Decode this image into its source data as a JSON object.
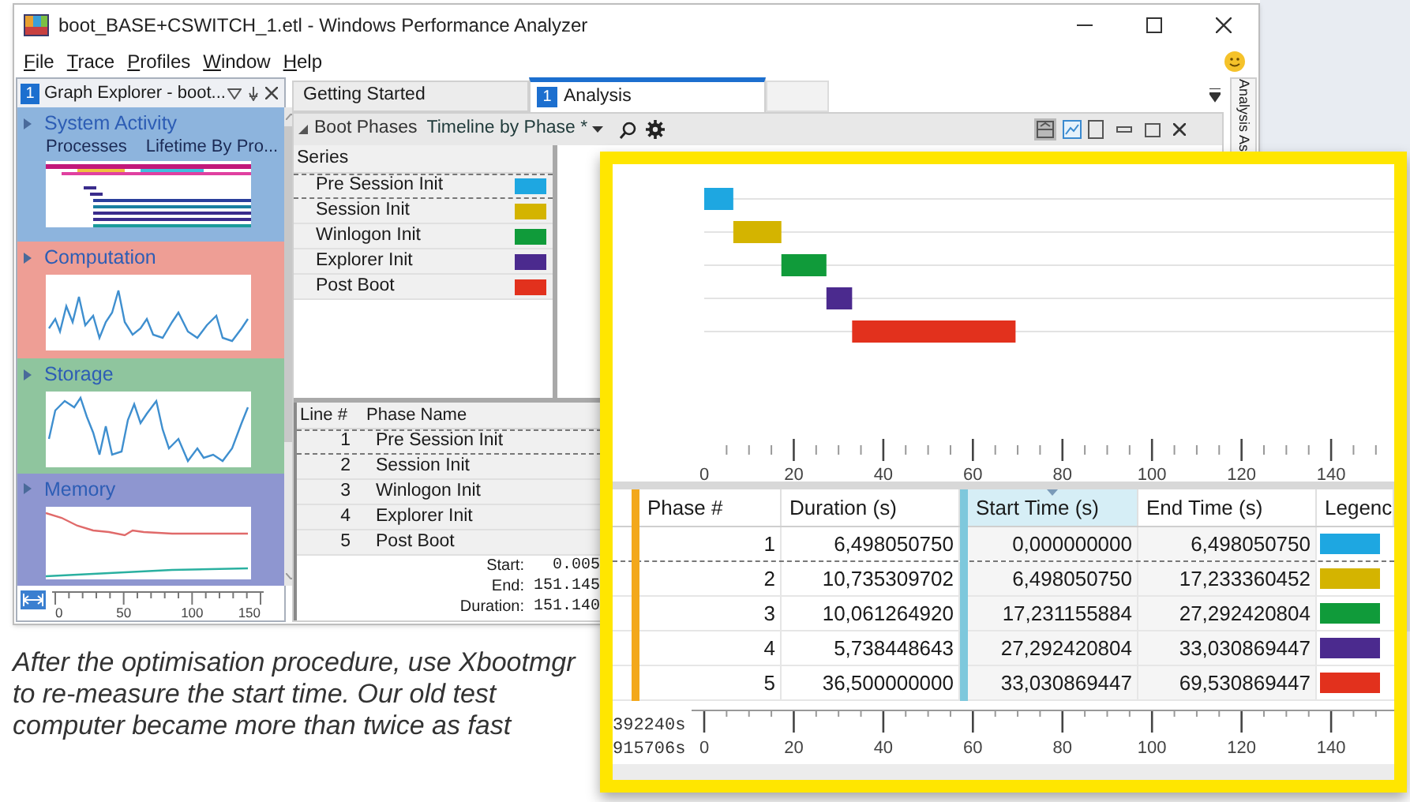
{
  "window": {
    "title": "boot_BASE+CSWITCH_1.etl - Windows Performance Analyzer"
  },
  "menu": [
    "File",
    "Trace",
    "Profiles",
    "Window",
    "Help"
  ],
  "graph_explorer": {
    "badge": "1",
    "title": "Graph Explorer - boot...",
    "sections": [
      {
        "kind": "lanes",
        "title": "System Activity",
        "subtitles": [
          "Processes",
          "Lifetime By Pro..."
        ],
        "color": "#8db4dd"
      },
      {
        "kind": "cpu",
        "title": "Computation",
        "color": "#ee9e95"
      },
      {
        "kind": "disk",
        "title": "Storage",
        "color": "#8fc59e"
      },
      {
        "kind": "memory",
        "title": "Memory",
        "color": "#8e96d0"
      }
    ],
    "axis_ticks": [
      "0",
      "50",
      "100",
      "150"
    ]
  },
  "tabs": [
    {
      "label": "Getting Started",
      "selected": false
    },
    {
      "badge": "1",
      "label": "Analysis",
      "selected": true
    }
  ],
  "toolbar": {
    "graph_name": "Boot Phases",
    "preset": "Timeline by Phase *"
  },
  "series": {
    "header": "Series",
    "items": [
      {
        "label": "Pre Session Init",
        "color": "#1ea7e1",
        "selected": true
      },
      {
        "label": "Session Init",
        "color": "#d4b400",
        "selected": false
      },
      {
        "label": "Winlogon Init",
        "color": "#109b3a",
        "selected": false
      },
      {
        "label": "Explorer Init",
        "color": "#4b2a8e",
        "selected": false
      },
      {
        "label": "Post Boot",
        "color": "#e2311d",
        "selected": false
      }
    ]
  },
  "phase_table": {
    "columns": [
      "Line #",
      "Phase Name"
    ],
    "rows": [
      {
        "line": "1",
        "name": "Pre Session Init",
        "selected": true
      },
      {
        "line": "2",
        "name": "Session Init",
        "selected": false
      },
      {
        "line": "3",
        "name": "Winlogon Init",
        "selected": false
      },
      {
        "line": "4",
        "name": "Explorer Init",
        "selected": false
      },
      {
        "line": "5",
        "name": "Post Boot",
        "selected": false
      }
    ]
  },
  "summary": [
    {
      "label": "Start:",
      "value": "0.005"
    },
    {
      "label": "End:",
      "value": "151.145"
    },
    {
      "label": "Duration:",
      "value": "151.140"
    }
  ],
  "side_tab": "Analysis As",
  "inset": {
    "timeline_ticks": [
      "0",
      "20",
      "40",
      "60",
      "80",
      "100",
      "120",
      "140"
    ],
    "table": {
      "columns": [
        "Phase #",
        "Duration (s)",
        "Start Time (s)",
        "End Time (s)",
        "Legenc"
      ],
      "rows": [
        {
          "phase": "1",
          "duration": "6,498050750",
          "start": "0,000000000",
          "end": "6,498050750",
          "color": "#1ea7e1",
          "selected": true
        },
        {
          "phase": "2",
          "duration": "10,735309702",
          "start": "6,498050750",
          "end": "17,233360452",
          "color": "#d4b400",
          "selected": false
        },
        {
          "phase": "3",
          "duration": "10,061264920",
          "start": "17,231155884",
          "end": "27,292420804",
          "color": "#109b3a",
          "selected": false
        },
        {
          "phase": "4",
          "duration": "5,738448643",
          "start": "27,292420804",
          "end": "33,030869447",
          "color": "#4b2a8e",
          "selected": false
        },
        {
          "phase": "5",
          "duration": "36,500000000",
          "start": "33,030869447",
          "end": "69,530869447",
          "color": "#e2311d",
          "selected": false
        }
      ]
    },
    "axis_labels": [
      "392240s",
      "915706s"
    ],
    "axis_ticks": [
      "0",
      "20",
      "40",
      "60",
      "80",
      "100",
      "120",
      "140"
    ]
  },
  "caption": "After the optimisation procedure, use Xbootmgr to re-measure the start time. Our old test computer became more than twice as fast"
}
